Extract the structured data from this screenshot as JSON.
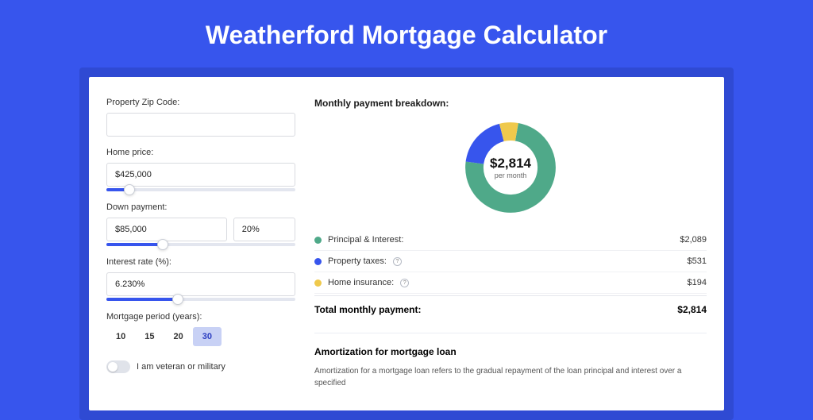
{
  "title": "Weatherford Mortgage Calculator",
  "colors": {
    "teal": "#4fa989",
    "blue": "#3755ed",
    "yellow": "#efc94c"
  },
  "form": {
    "zip": {
      "label": "Property Zip Code:",
      "value": ""
    },
    "home_price": {
      "label": "Home price:",
      "value": "$425,000",
      "slider_pct": 12
    },
    "down_payment": {
      "label": "Down payment:",
      "amount": "$85,000",
      "percent": "20%",
      "slider_pct": 30
    },
    "interest_rate": {
      "label": "Interest rate (%):",
      "value": "6.230%",
      "slider_pct": 38
    },
    "period": {
      "label": "Mortgage period (years):",
      "options": [
        "10",
        "15",
        "20",
        "30"
      ],
      "active": 3
    },
    "veteran": {
      "label": "I am veteran or military",
      "on": false
    }
  },
  "breakdown": {
    "title": "Monthly payment breakdown:",
    "chart_data": {
      "type": "pie",
      "series": [
        {
          "name": "Principal & Interest",
          "value": 2089,
          "color": "#4fa989"
        },
        {
          "name": "Property taxes",
          "value": 531,
          "color": "#3755ed"
        },
        {
          "name": "Home insurance",
          "value": 194,
          "color": "#efc94c"
        }
      ],
      "center_value": "$2,814",
      "center_sub": "per month"
    },
    "rows": [
      {
        "label": "Principal & Interest:",
        "color": "#4fa989",
        "info": false,
        "value": "$2,089"
      },
      {
        "label": "Property taxes:",
        "color": "#3755ed",
        "info": true,
        "value": "$531"
      },
      {
        "label": "Home insurance:",
        "color": "#efc94c",
        "info": true,
        "value": "$194"
      }
    ],
    "total_label": "Total monthly payment:",
    "total_value": "$2,814"
  },
  "amortization": {
    "title": "Amortization for mortgage loan",
    "text": "Amortization for a mortgage loan refers to the gradual repayment of the loan principal and interest over a specified"
  }
}
